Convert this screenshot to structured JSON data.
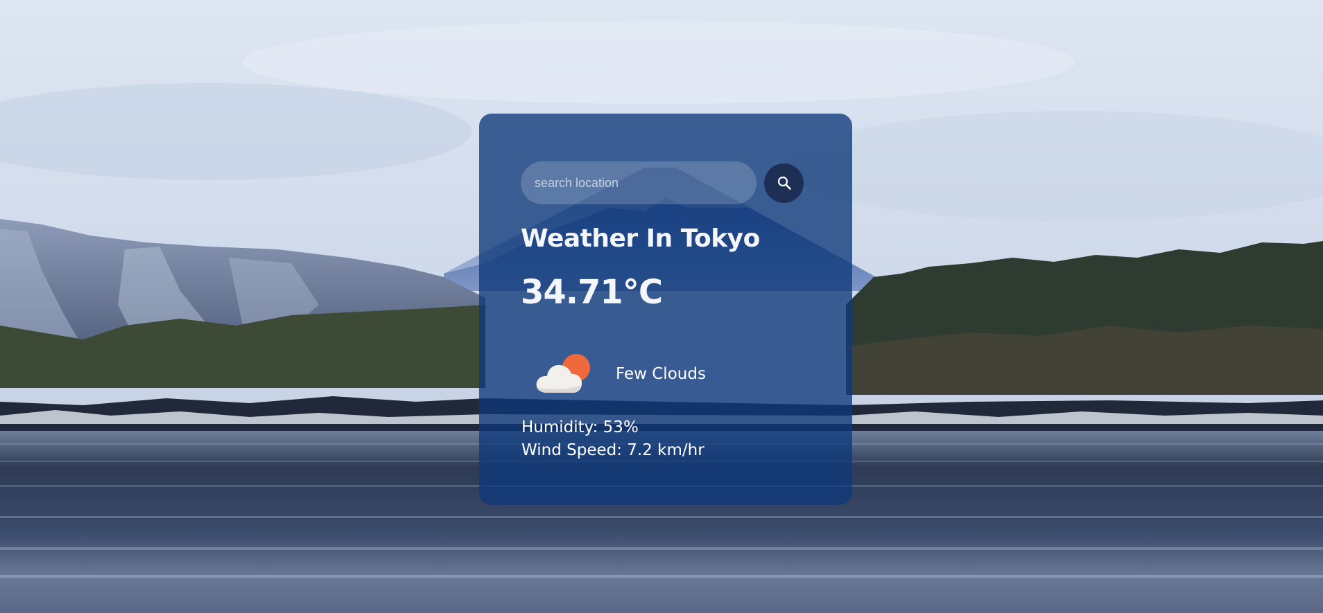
{
  "search": {
    "placeholder": "search location",
    "button_icon": "search-icon"
  },
  "weather": {
    "title": "Weather In Tokyo",
    "temperature": "34.71°C",
    "condition": "Few Clouds",
    "condition_icon": "cloud-sun-icon",
    "humidity": "Humidity: 53%",
    "wind": "Wind Speed: 7.2 km/hr"
  },
  "colors": {
    "card_background": "#0e387a",
    "text": "#ffffff",
    "sun": "#ee6a3d",
    "cloud": "#f1f0ec"
  },
  "background_scene": "mountain-lake-icon"
}
